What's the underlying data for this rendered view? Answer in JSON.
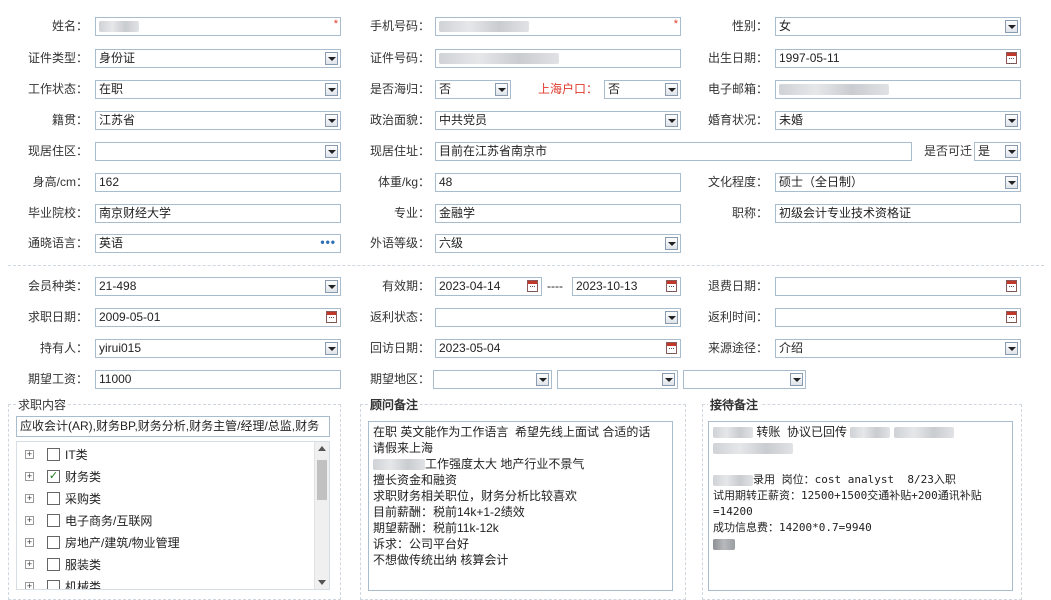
{
  "colors": {
    "border": "#a9bccd",
    "required": "#e0392b",
    "label": "#333333"
  },
  "profile": {
    "name_label": "姓名：",
    "phone_label": "手机号码：",
    "gender_label": "性别：",
    "gender_value": "女",
    "id_type_label": "证件类型：",
    "id_type_value": "身份证",
    "id_number_label": "证件号码：",
    "birth_label": "出生日期：",
    "birth_value": "1997-05-11",
    "work_status_label": "工作状态：",
    "work_status_value": "在职",
    "returnee_label": "是否海归：",
    "returnee_value": "否",
    "shanghai_hukou_label": "上海户口：",
    "shanghai_hukou_value": "否",
    "email_label": "电子邮箱：",
    "native_label": "籍贯：",
    "native_value": "江苏省",
    "political_label": "政治面貌：",
    "political_value": "中共党员",
    "marital_label": "婚育状况：",
    "marital_value": "未婚",
    "current_residence_label": "现居住区：",
    "current_residence_value": "",
    "current_address_label": "现居住址：",
    "current_address_value": "目前在江苏省南京市",
    "relocate_label": "是否可迁",
    "relocate_value": "是",
    "height_label": "身高/cm：",
    "height_value": "162",
    "weight_label": "体重/kg：",
    "weight_value": "48",
    "education_label": "文化程度：",
    "education_value": "硕士（全日制）",
    "school_label": "毕业院校：",
    "school_value": "南京财经大学",
    "major_label": "专业：",
    "major_value": "金融学",
    "title_label": "职称：",
    "title_value": "初级会计专业技术资格证",
    "language_label": "通晓语言：",
    "language_value": "英语",
    "language_more": "•••",
    "language_level_label": "外语等级：",
    "language_level_value": "六级"
  },
  "membership": {
    "member_type_label": "会员种类：",
    "member_type_value": "21-498",
    "valid_label": "有效期：",
    "valid_from": "2023-04-14",
    "valid_sep": "----",
    "valid_to": "2023-10-13",
    "refund_date_label": "退费日期：",
    "refund_date_value": "",
    "job_date_label": "求职日期：",
    "job_date_value": "2009-05-01",
    "rebate_status_label": "返利状态：",
    "rebate_status_value": "",
    "rebate_time_label": "返利时间：",
    "rebate_time_value": "",
    "holder_label": "持有人：",
    "holder_value": "yirui015",
    "visit_date_label": "回访日期：",
    "visit_date_value": "2023-05-04",
    "source_label": "来源途径：",
    "source_value": "介绍",
    "expected_salary_label": "期望工资：",
    "expected_salary_value": "11000",
    "expected_area_label": "期望地区："
  },
  "job_content": {
    "title": "求职内容",
    "summary": "应收会计(AR),财务BP,财务分析,财务主管/经理/总监,财务",
    "tree": [
      {
        "label": "IT类",
        "checked": false
      },
      {
        "label": "财务类",
        "checked": true
      },
      {
        "label": "采购类",
        "checked": false
      },
      {
        "label": "电子商务/互联网",
        "checked": false
      },
      {
        "label": "房地产/建筑/物业管理",
        "checked": false
      },
      {
        "label": "服装类",
        "checked": false
      },
      {
        "label": "机械类",
        "checked": false
      }
    ],
    "expand_symbol": "+",
    "check_symbol": "✓"
  },
  "consultant_notes": {
    "title": "顾问备注",
    "lines": [
      "在职 英文能作为工作语言  希望先线上面试 合适的话",
      "请假来上海",
      "工作强度太大 地产行业不景气",
      "擅长资金和融资",
      "求职财务相关职位，财务分析比较喜欢",
      "目前薪酬：税前14k+1-2绩效",
      "期望薪酬：税前11k-12k",
      "诉求：公司平台好",
      "不想做传统出纳 核算会计"
    ]
  },
  "reception_notes": {
    "title": "接待备注",
    "line1": "转账  协议已回传",
    "line2": "录用 岗位：cost analyst  8/23入职",
    "line3": "试用期转正薪资：12500+1500交通补贴+200通讯补贴",
    "line4": "=14200",
    "line5": "成功信息费：14200*0.7=9940"
  }
}
